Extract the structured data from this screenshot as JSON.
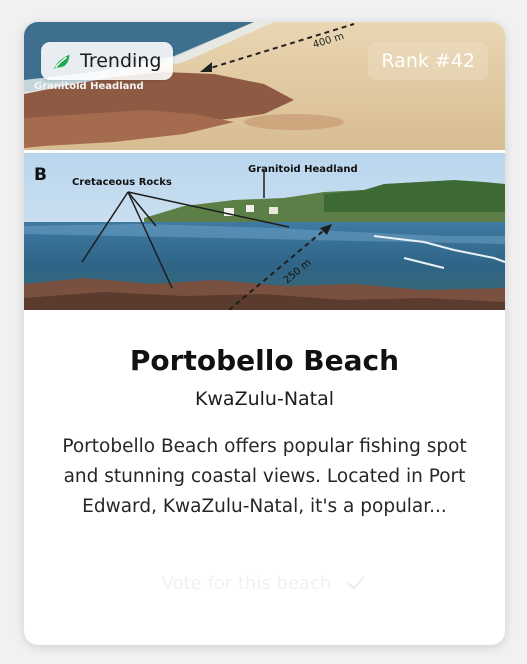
{
  "card": {
    "badge": {
      "label": "Trending",
      "icon": "leaf-icon",
      "icon_color": "#1fa84f"
    },
    "rank_label": "Rank #42",
    "photo": {
      "description_labels": {
        "panel_letter": "B",
        "label_top": "Granitoid Headland",
        "label_rocks": "Cretaceous Rocks",
        "label_headland": "Granitoid Headland",
        "distance_top": "400 m",
        "distance_bottom": "250 m"
      }
    },
    "title": "Portobello Beach",
    "region": "KwaZulu-Natal",
    "description": "Portobello Beach offers popular fishing spot and stunning coastal views. Located in Port Edward, KwaZulu-Natal, it's a popular...",
    "vote_button": {
      "label": "Vote for this beach",
      "icon": "check-icon"
    }
  }
}
